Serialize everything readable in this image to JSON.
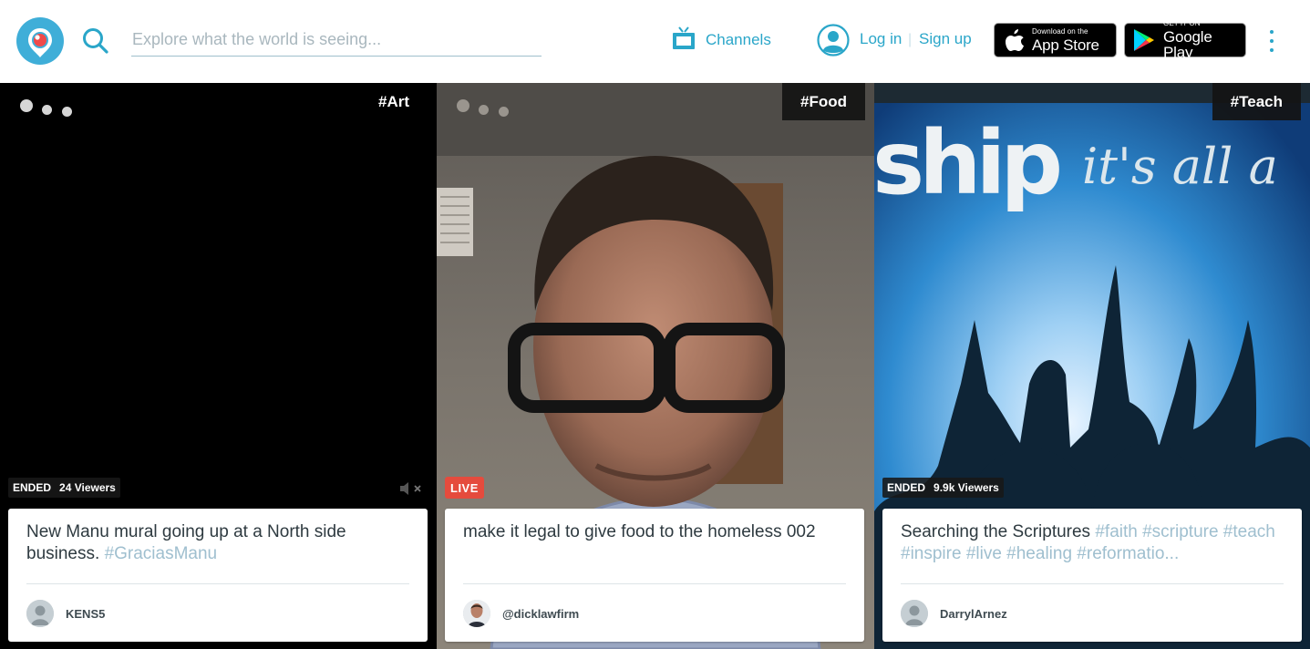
{
  "header": {
    "search_placeholder": "Explore what the world is seeing...",
    "channels_label": "Channels",
    "login_label": "Log in",
    "separator": "|",
    "signup_label": "Sign up",
    "appstore": {
      "small": "Download on the",
      "big": "App Store"
    },
    "googleplay": {
      "small": "GET IT ON",
      "big": "Google Play"
    },
    "accent_color": "#2aa6c9"
  },
  "tiles": [
    {
      "tag": "#Art",
      "status": "ENDED",
      "viewers": "24 Viewers",
      "title": "New Manu mural going up at a North side business.",
      "hashtags": "#GraciasManu",
      "username": "KENS5"
    },
    {
      "tag": "#Food",
      "status": "LIVE",
      "title": "make it legal to give food to the homeless 002",
      "hashtags": "",
      "username": "@dicklawfirm"
    },
    {
      "tag": "#Teach",
      "status": "ENDED",
      "viewers": "9.9k Viewers",
      "title": "Searching the Scriptures",
      "hashtags": "#faith #scripture #teach #inspire #live #healing #reformatio...",
      "username": "DarrylArnez",
      "background_text_1": "ship",
      "background_text_2": "it's all a"
    }
  ],
  "colors": {
    "live": "#e54b3d",
    "hashtag": "#9fbfcf"
  }
}
